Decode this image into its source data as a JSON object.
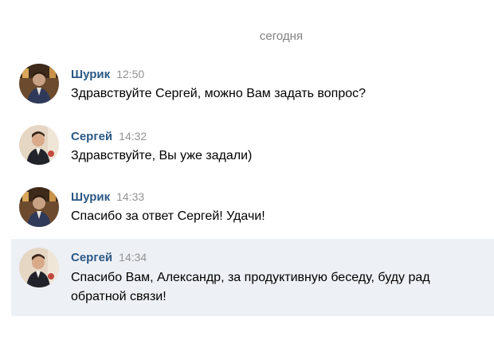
{
  "date_divider": "сегодня",
  "messages": [
    {
      "author": "Шурик",
      "time": "12:50",
      "text": "Здравствуйте Сергей, можно Вам задать вопрос?",
      "avatar_icon": "user-photo-shurik"
    },
    {
      "author": "Сергей",
      "time": "14:32",
      "text": "Здравствуйте, Вы уже задали)",
      "avatar_icon": "user-photo-sergey"
    },
    {
      "author": "Шурик",
      "time": "14:33",
      "text": "Спасибо за ответ Сергей! Удачи!",
      "avatar_icon": "user-photo-shurik"
    },
    {
      "author": "Сергей",
      "time": "14:34",
      "text": "Спасибо Вам, Александр, за продуктивную беседу, буду рад обратной связи!",
      "avatar_icon": "user-photo-sergey",
      "highlighted": true
    }
  ],
  "colors": {
    "author_link": "#2a5885",
    "timestamp": "#939393",
    "date_divider": "#828282",
    "highlight_background": "#edf0f5"
  }
}
